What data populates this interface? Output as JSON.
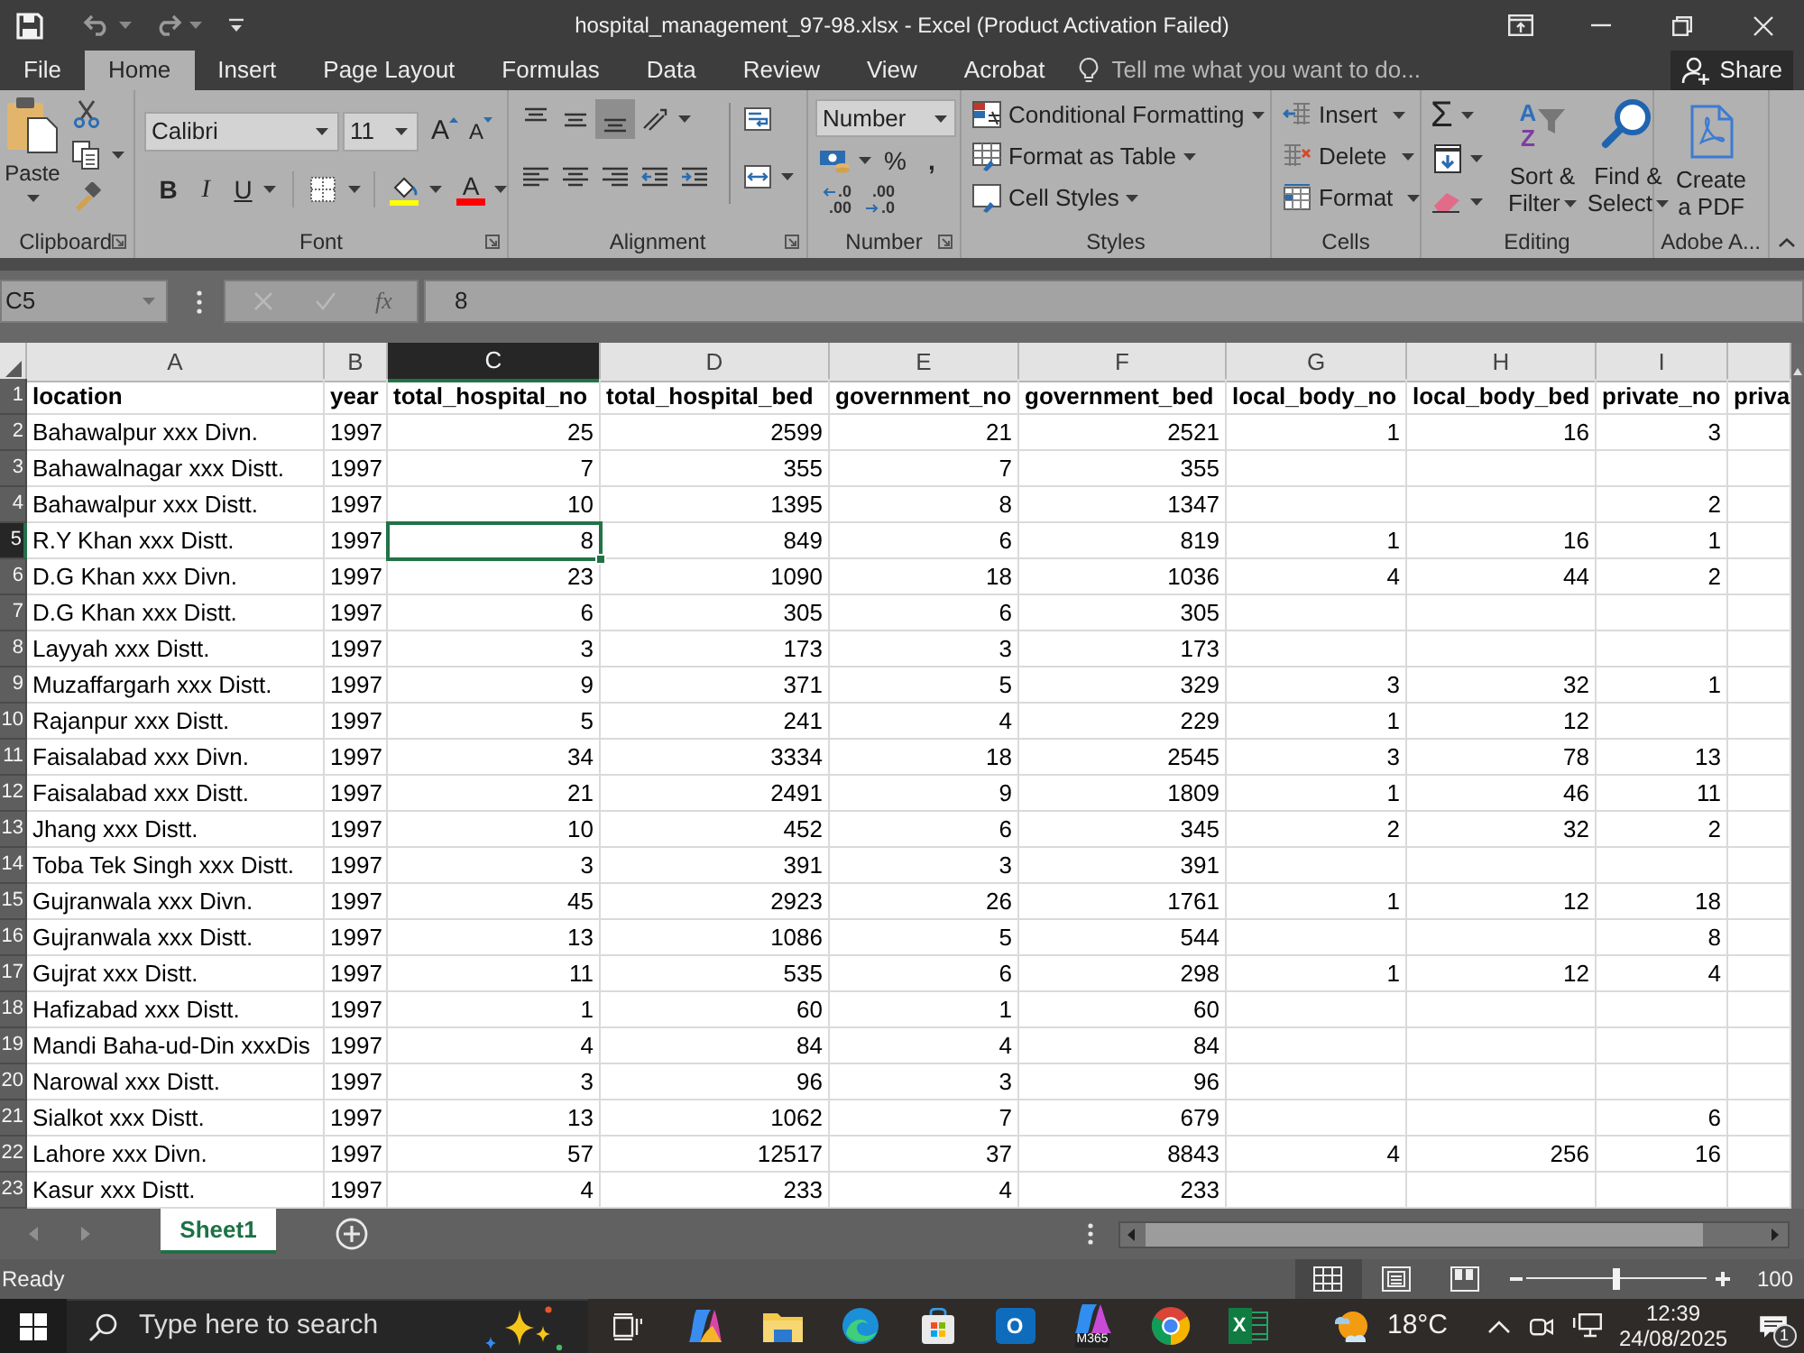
{
  "title_bar": {
    "title": "hospital_management_97-98.xlsx - Excel (Product Activation Failed)"
  },
  "menu_tabs": [
    {
      "label": "File",
      "selected": false
    },
    {
      "label": "Home",
      "selected": true
    },
    {
      "label": "Insert",
      "selected": false
    },
    {
      "label": "Page Layout",
      "selected": false
    },
    {
      "label": "Formulas",
      "selected": false
    },
    {
      "label": "Data",
      "selected": false
    },
    {
      "label": "Review",
      "selected": false
    },
    {
      "label": "View",
      "selected": false
    },
    {
      "label": "Acrobat",
      "selected": false
    }
  ],
  "tell_me": {
    "placeholder": "Tell me what you want to do..."
  },
  "share": {
    "label": "Share"
  },
  "ribbon": {
    "clipboard": {
      "label": "Clipboard",
      "paste": "Paste"
    },
    "font": {
      "label": "Font",
      "font_name": "Calibri",
      "font_size": "11",
      "grow": "A",
      "shrink": "A",
      "bold": "B",
      "italic": "I",
      "underline": "U",
      "font_color": "A"
    },
    "alignment": {
      "label": "Alignment",
      "rows": [
        [
          {
            "kind": "top_align",
            "on": false
          },
          {
            "kind": "middle_align",
            "on": false
          },
          {
            "kind": "bottom_align",
            "on": true
          },
          {
            "kind": "orientation",
            "on": false
          },
          {
            "kind": "wrap_text",
            "on": false
          }
        ],
        [
          {
            "kind": "align_left",
            "on": false
          },
          {
            "kind": "center",
            "on": false
          },
          {
            "kind": "align_right",
            "on": false
          },
          {
            "kind": "decrease_indent",
            "on": false
          },
          {
            "kind": "increase_indent",
            "on": false
          },
          {
            "kind": "merge_center",
            "on": false
          }
        ]
      ]
    },
    "number": {
      "label": "Number",
      "format": "Number",
      "percent": "%",
      "comma": ",",
      "increase_decimal": [
        ".0",
        ".00"
      ],
      "decrease_decimal": [
        ".00",
        ".0"
      ]
    },
    "styles": {
      "label": "Styles",
      "commands": [
        {
          "kind": "conditional_formatting",
          "label": "Conditional Formatting"
        },
        {
          "kind": "format_as_table",
          "label": "Format as Table"
        },
        {
          "kind": "cell_styles",
          "label": "Cell Styles"
        }
      ]
    },
    "cells": {
      "label": "Cells",
      "commands": [
        {
          "kind": "insert",
          "label": "Insert"
        },
        {
          "kind": "delete",
          "label": "Delete"
        },
        {
          "kind": "format",
          "label": "Format"
        }
      ]
    },
    "editing": {
      "label": "Editing",
      "autosum": "Σ",
      "sort": {
        "letters": [
          "A",
          "Z"
        ],
        "lines": [
          "Sort &",
          "Filter"
        ]
      },
      "find": {
        "lines": [
          "Find &",
          "Select"
        ]
      }
    },
    "adobe": {
      "label": "Adobe A...",
      "create": [
        "Create",
        "a PDF"
      ]
    }
  },
  "formula_bar": {
    "name_box": "C5",
    "function_label": "fx",
    "value": "8"
  },
  "table": {
    "columns": [
      {
        "letter": "A",
        "selected": false
      },
      {
        "letter": "B",
        "selected": false
      },
      {
        "letter": "C",
        "selected": true
      },
      {
        "letter": "D",
        "selected": false
      },
      {
        "letter": "E",
        "selected": false
      },
      {
        "letter": "F",
        "selected": false
      },
      {
        "letter": "G",
        "selected": false
      },
      {
        "letter": "H",
        "selected": false
      },
      {
        "letter": "I",
        "selected": false
      },
      {
        "selected": false
      }
    ],
    "header_row": {
      "number": "1",
      "selected": false,
      "cells": [
        "location",
        "year",
        "total_hospital_no",
        "total_hospital_bed",
        "government_no",
        "government_bed",
        "local_body_no",
        "local_body_bed",
        "private_no",
        "priva"
      ]
    },
    "rows": [
      {
        "number": "2",
        "selected": false,
        "cells": [
          "Bahawalpur xxx Divn.",
          "1997",
          "25",
          "2599",
          "21",
          "2521",
          "1",
          "16",
          "3"
        ]
      },
      {
        "number": "3",
        "selected": false,
        "cells": [
          "Bahawalnagar xxx Distt.",
          "1997",
          "7",
          "355",
          "7",
          "355"
        ]
      },
      {
        "number": "4",
        "selected": false,
        "cells": [
          "Bahawalpur xxx Distt.",
          "1997",
          "10",
          "1395",
          "8",
          "1347",
          null,
          null,
          "2"
        ]
      },
      {
        "number": "5",
        "selected": true,
        "cells": [
          "R.Y Khan xxx Distt.",
          "1997",
          "8",
          "849",
          "6",
          "819",
          "1",
          "16",
          "1"
        ]
      },
      {
        "number": "6",
        "selected": false,
        "cells": [
          "D.G Khan xxx Divn.",
          "1997",
          "23",
          "1090",
          "18",
          "1036",
          "4",
          "44",
          "2"
        ]
      },
      {
        "number": "7",
        "selected": false,
        "cells": [
          "D.G Khan xxx Distt.",
          "1997",
          "6",
          "305",
          "6",
          "305"
        ]
      },
      {
        "number": "8",
        "selected": false,
        "cells": [
          "Layyah xxx Distt.",
          "1997",
          "3",
          "173",
          "3",
          "173"
        ]
      },
      {
        "number": "9",
        "selected": false,
        "cells": [
          "Muzaffargarh xxx Distt.",
          "1997",
          "9",
          "371",
          "5",
          "329",
          "3",
          "32",
          "1"
        ]
      },
      {
        "number": "10",
        "selected": false,
        "cells": [
          "Rajanpur xxx Distt.",
          "1997",
          "5",
          "241",
          "4",
          "229",
          "1",
          "12"
        ]
      },
      {
        "number": "11",
        "selected": false,
        "cells": [
          "Faisalabad xxx Divn.",
          "1997",
          "34",
          "3334",
          "18",
          "2545",
          "3",
          "78",
          "13"
        ]
      },
      {
        "number": "12",
        "selected": false,
        "cells": [
          "Faisalabad xxx Distt.",
          "1997",
          "21",
          "2491",
          "9",
          "1809",
          "1",
          "46",
          "11"
        ]
      },
      {
        "number": "13",
        "selected": false,
        "cells": [
          "Jhang xxx Distt.",
          "1997",
          "10",
          "452",
          "6",
          "345",
          "2",
          "32",
          "2"
        ]
      },
      {
        "number": "14",
        "selected": false,
        "cells": [
          "Toba Tek Singh xxx Distt.",
          "1997",
          "3",
          "391",
          "3",
          "391"
        ]
      },
      {
        "number": "15",
        "selected": false,
        "cells": [
          "Gujranwala xxx Divn.",
          "1997",
          "45",
          "2923",
          "26",
          "1761",
          "1",
          "12",
          "18"
        ]
      },
      {
        "number": "16",
        "selected": false,
        "cells": [
          "Gujranwala xxx Distt.",
          "1997",
          "13",
          "1086",
          "5",
          "544",
          null,
          null,
          "8"
        ]
      },
      {
        "number": "17",
        "selected": false,
        "cells": [
          "Gujrat xxx Distt.",
          "1997",
          "11",
          "535",
          "6",
          "298",
          "1",
          "12",
          "4"
        ]
      },
      {
        "number": "18",
        "selected": false,
        "cells": [
          "Hafizabad xxx Distt.",
          "1997",
          "1",
          "60",
          "1",
          "60"
        ]
      },
      {
        "number": "19",
        "selected": false,
        "cells": [
          "Mandi Baha-ud-Din xxxDis",
          "1997",
          "4",
          "84",
          "4",
          "84"
        ]
      },
      {
        "number": "20",
        "selected": false,
        "cells": [
          "Narowal xxx Distt.",
          "1997",
          "3",
          "96",
          "3",
          "96"
        ]
      },
      {
        "number": "21",
        "selected": false,
        "cells": [
          "Sialkot xxx Distt.",
          "1997",
          "13",
          "1062",
          "7",
          "679",
          null,
          null,
          "6"
        ]
      },
      {
        "number": "22",
        "selected": false,
        "cells": [
          "Lahore xxx Divn.",
          "1997",
          "57",
          "12517",
          "37",
          "8843",
          "4",
          "256",
          "16"
        ]
      },
      {
        "number": "23",
        "selected": false,
        "cells": [
          "Kasur xxx Distt.",
          "1997",
          "4",
          "233",
          "4",
          "233"
        ]
      }
    ]
  },
  "sheet_bar": {
    "sheets": [
      {
        "name": "Sheet1",
        "selected": true
      }
    ]
  },
  "status_bar": {
    "status": "Ready",
    "views": [
      {
        "kind": "normal",
        "selected": true
      },
      {
        "kind": "page_layout",
        "selected": false
      },
      {
        "kind": "page_break",
        "selected": false
      }
    ],
    "zoom": {
      "level": 0.5,
      "reading": "100"
    }
  },
  "taskbar": {
    "search": {
      "placeholder": "Type here to search"
    },
    "apps": [
      {
        "kind": "task_view"
      },
      {
        "kind": "copilot"
      },
      {
        "kind": "file_explorer"
      },
      {
        "kind": "edge"
      },
      {
        "kind": "store"
      },
      {
        "kind": "outlook",
        "letter": "O"
      },
      {
        "kind": "m365",
        "label": "M365"
      },
      {
        "kind": "chrome"
      },
      {
        "kind": "excel",
        "letter": "X"
      }
    ],
    "weather": {
      "temperature": "18°C"
    },
    "clock": {
      "time": "12:39",
      "date": "24/08/2025"
    },
    "notifications": {
      "count": "1"
    }
  }
}
